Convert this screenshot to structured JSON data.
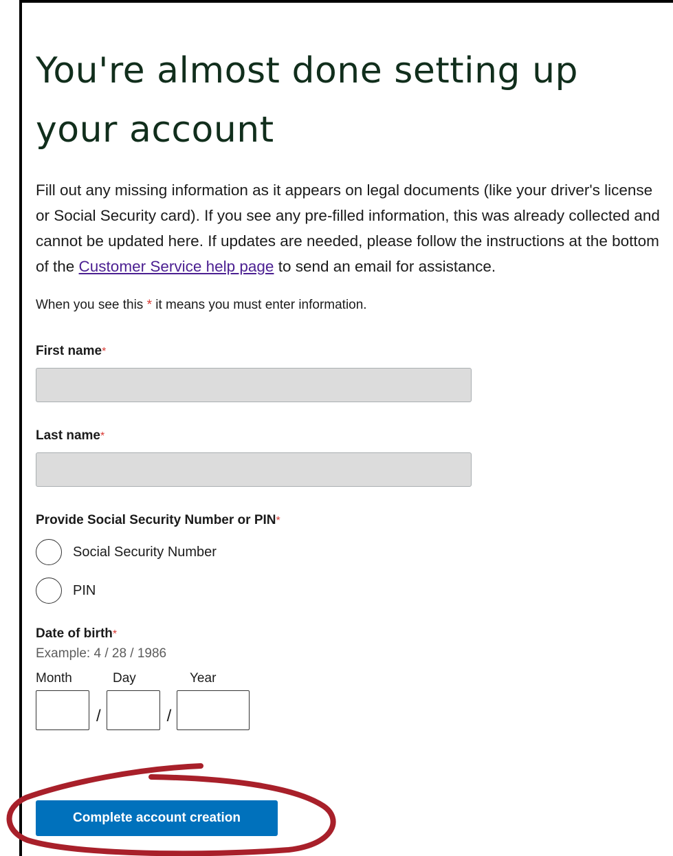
{
  "page": {
    "title": "You're almost done setting up your account",
    "intro_before_link": "Fill out any missing information as it appears on legal documents (like your driver's license or Social Security card). If you see any pre-filled information, this was already collected and cannot be updated here. If updates are needed, please follow the instructions at the bottom of the ",
    "intro_link": "Customer Service help page",
    "intro_after_link": " to send an email for assistance.",
    "required_note_before": "When you see this ",
    "required_star": "*",
    "required_note_after": " it means you must enter information."
  },
  "form": {
    "first_name_label": "First name",
    "last_name_label": "Last name",
    "ssn_pin_label": "Provide Social Security Number or PIN",
    "radio_options": [
      "Social Security Number",
      "PIN"
    ],
    "dob_label": "Date of birth",
    "dob_hint": "Example: 4 / 28 / 1986",
    "dob_month": "Month",
    "dob_day": "Day",
    "dob_year": "Year",
    "dob_separator": "/",
    "submit_label": "Complete account creation"
  },
  "colors": {
    "heading": "#112e1c",
    "link": "#4b1f91",
    "required": "#d83933",
    "button": "#0071bc",
    "annotation": "#a8202a"
  }
}
